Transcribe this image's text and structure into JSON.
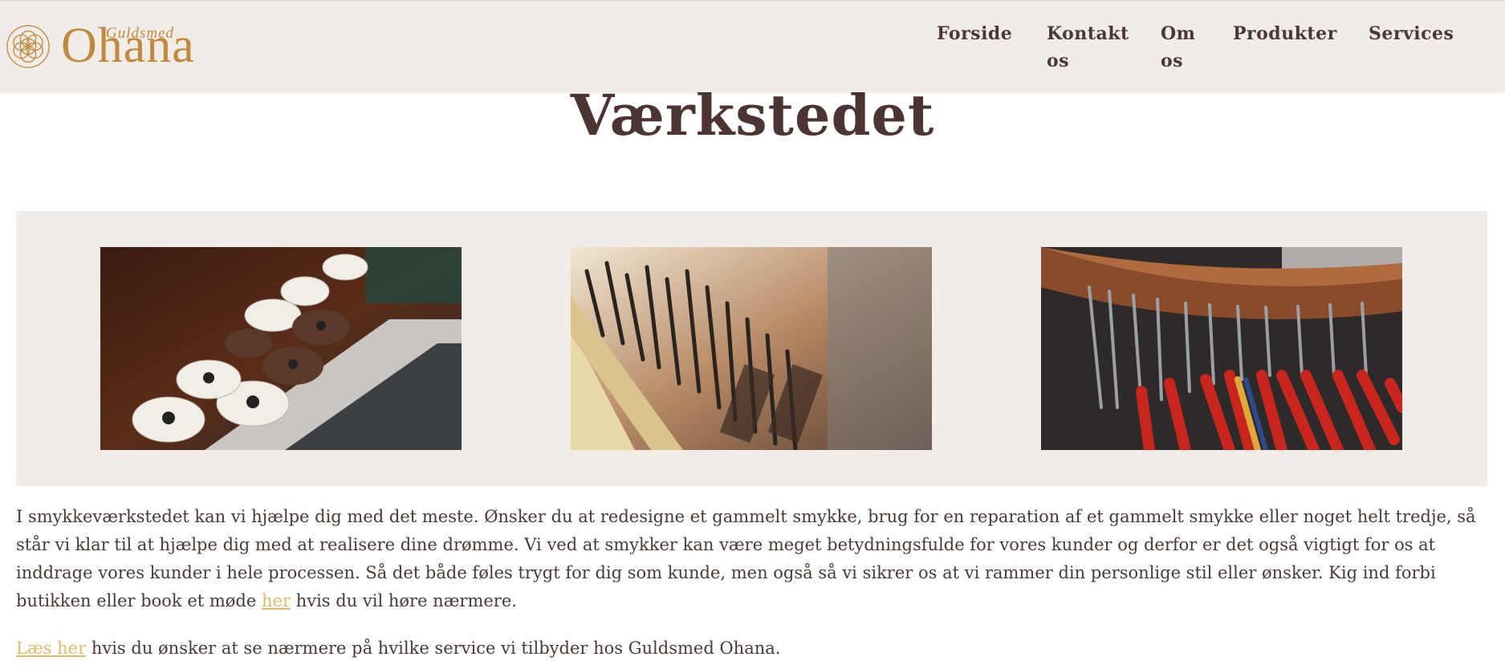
{
  "brand": {
    "name": "Ohana",
    "script_text": "Guldsmed",
    "accent_color": "#c08a3e"
  },
  "nav": {
    "items": [
      {
        "label": "Forside"
      },
      {
        "label": "Kontakt os"
      },
      {
        "label": "Om os"
      },
      {
        "label": "Produkter"
      },
      {
        "label": "Services"
      }
    ]
  },
  "page": {
    "title": "Værkstedet"
  },
  "gallery": {
    "images": [
      {
        "description": "polishing-wheels-photo"
      },
      {
        "description": "engraving-burs-photo"
      },
      {
        "description": "pliers-rack-photo"
      }
    ]
  },
  "content": {
    "paragraph1": "I smykkeværkstedet kan vi hjælpe dig med det meste. Ønsker du at redesigne et gammelt smykke, brug for en reparation af et gammelt smykke eller noget helt tredje, så står vi klar til at hjælpe dig med at realisere dine drømme. Vi ved at smykker kan være meget betydningsfulde for vores kunder og derfor er det også vigtigt for os at inddrage vores kunder i hele processen. Så det både føles trygt for dig som kunde, men også så vi sikrer os at vi rammer din personlige stil eller ønsker. Kig ind forbi butikken eller book et møde",
    "paragraph1_link": "her",
    "paragraph1_tail": "hvis du vil høre nærmere.",
    "paragraph2_link": "Læs her",
    "paragraph2_tail": "hvis du ønsker at se nærmere på hvilke service vi tilbyder hos Guldsmed Ohana.",
    "link_color": "#e2b96a"
  }
}
